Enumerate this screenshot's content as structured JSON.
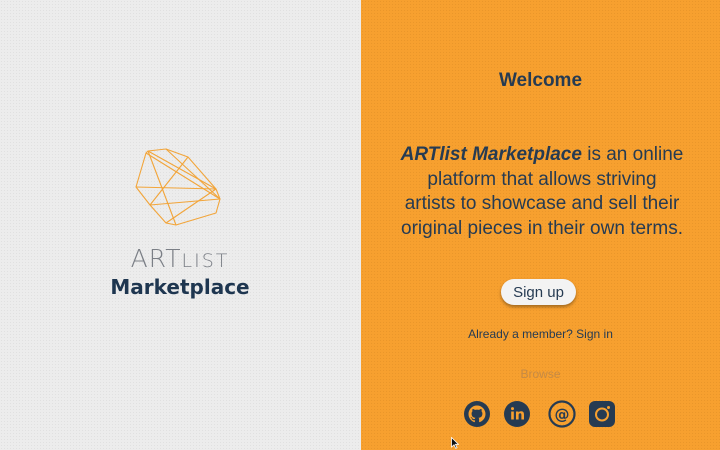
{
  "logo": {
    "art": "ART",
    "list": "LIST",
    "marketplace": "Marketplace"
  },
  "welcome": {
    "title": "Welcome",
    "brand": "ARTlist Marketplace",
    "description": " is an online platform that allows striving artists to showcase and sell their original pieces in their own terms."
  },
  "actions": {
    "signup_label": "Sign up",
    "member_prompt": "Already a member? ",
    "signin_label": "Sign in",
    "browse_label": "Browse"
  },
  "social": [
    "github-icon",
    "linkedin-icon",
    "email-icon",
    "instagram-icon"
  ],
  "colors": {
    "accent": "#f7a02f",
    "navy": "#1e3650",
    "logo_line": "#f2a53a"
  }
}
